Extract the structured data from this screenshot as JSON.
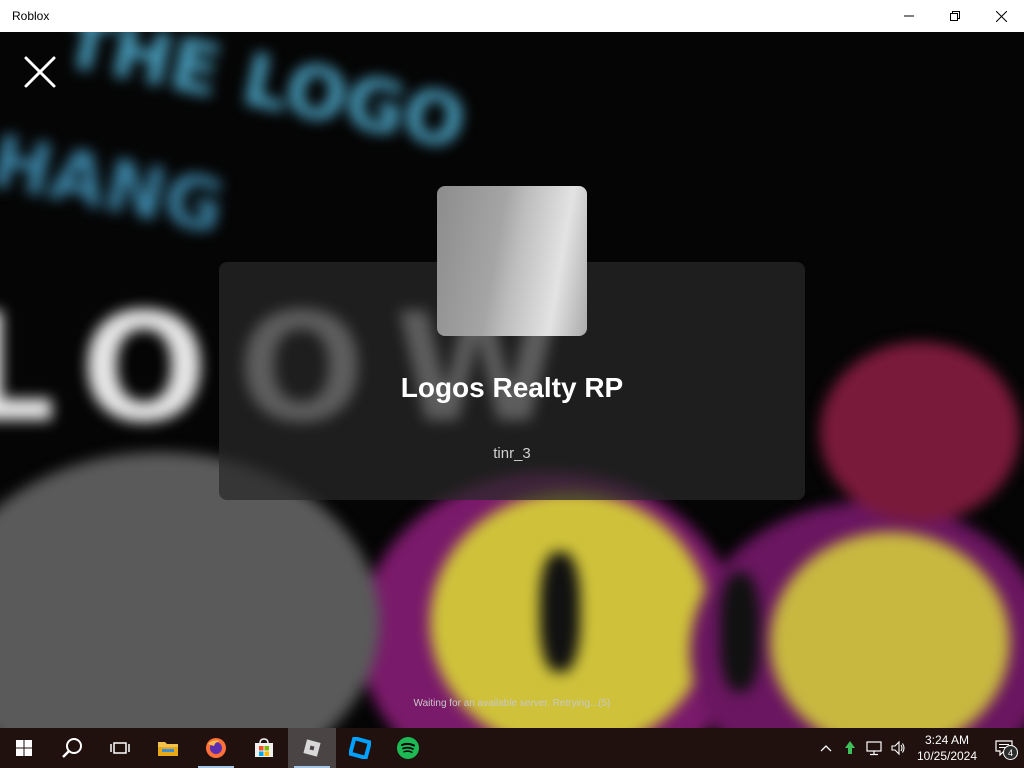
{
  "window": {
    "title": "Roblox"
  },
  "game": {
    "name": "Logos Realty RP",
    "creator": "tinr_3",
    "status": "Waiting for an available server. Retrying...(5)"
  },
  "background": {
    "text_lines": [
      "THE LOGO",
      "HANG",
      "LOOW"
    ]
  },
  "taskbar": {
    "apps": [
      "start",
      "search",
      "task-view",
      "file-explorer",
      "firefox",
      "microsoft-store",
      "roblox",
      "roblox-studio",
      "spotify"
    ],
    "time": "3:24 AM",
    "date": "10/25/2024",
    "notification_count": "4"
  },
  "colors": {
    "taskbar_bg": "#20100e",
    "card_bg": "rgba(40,40,40,0.72)",
    "spotify": "#1db954",
    "roblox_studio": "#00a2ff"
  }
}
